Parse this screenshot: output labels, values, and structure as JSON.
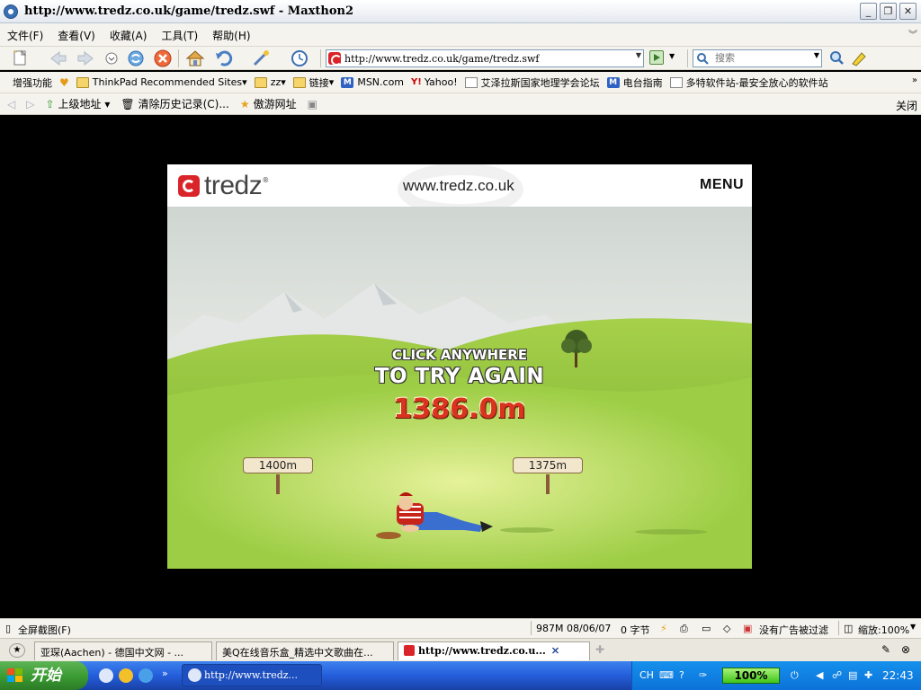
{
  "window": {
    "title": "http://www.tredz.co.uk/game/tredz.swf - Maxthon2",
    "buttons": [
      "_",
      "❐",
      "✕"
    ]
  },
  "menu": {
    "items": [
      "文件(F)",
      "查看(V)",
      "收藏(A)",
      "工具(T)",
      "帮助(H)"
    ]
  },
  "address": {
    "url": "http://www.tredz.co.uk/game/tredz.swf",
    "search_placeholder": "搜索"
  },
  "bookmarks": {
    "enhance_label": "增强功能",
    "items": [
      {
        "label": "ThinkPad Recommended Sites",
        "icon": "folder-icon"
      },
      {
        "label": "zz",
        "icon": "folder-icon"
      },
      {
        "label": "链接",
        "icon": "folder-icon"
      },
      {
        "label": "MSN.com",
        "icon": "msn-icon"
      },
      {
        "label": "Yahoo!",
        "icon": "yahoo-icon"
      },
      {
        "label": "艾泽拉斯国家地理学会论坛",
        "icon": "page-icon"
      },
      {
        "label": "电台指南",
        "icon": "msn-icon"
      },
      {
        "label": "多特软件站-最安全放心的软件站",
        "icon": "page-icon"
      }
    ]
  },
  "history": {
    "up_label": "上级地址",
    "clear_label": "清除历史记录(C)...",
    "fav_label": "傲游网址",
    "close_label": "关闭"
  },
  "game": {
    "brand": "tredz",
    "site": "www.tredz.co.uk",
    "menu_label": "MENU",
    "line1": "CLICK ANYWHERE",
    "line2": "TO TRY AGAIN",
    "distance": "1386.0m",
    "sign_left": "1400m",
    "sign_right": "1375m",
    "colors": {
      "sky": "#e6ece8",
      "grass": "#8cc43c",
      "distance": "#d8341e"
    }
  },
  "status": {
    "screenshot_label": "全屏截图(F)",
    "memory": "987M",
    "date": "08/06/07",
    "bytes": "0 字节",
    "ads": "没有广告被过滤",
    "zoom": "缩放:100%"
  },
  "tabs": [
    {
      "label": "亚琛(Aachen) - 德国中文网 - ...",
      "active": false
    },
    {
      "label": "美Q在线音乐盒_精选中文歌曲在...",
      "active": false
    },
    {
      "label": "http://www.tredz.co.u...",
      "active": true
    }
  ],
  "taskbar": {
    "start_label": "开始",
    "task_label": "http://www.tredz...",
    "ime": "CH",
    "battery": "100%",
    "clock": "22:43"
  }
}
